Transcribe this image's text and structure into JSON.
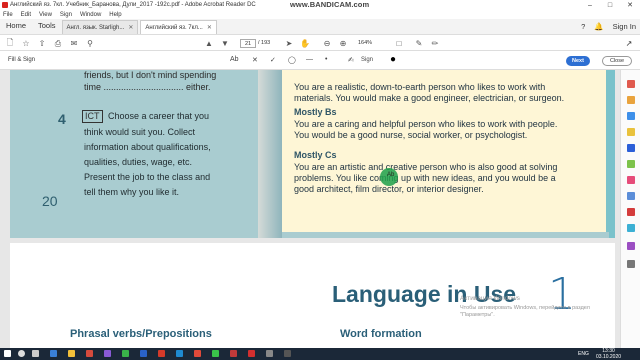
{
  "window": {
    "title": "Английский яз. 7кл. Учебник_Баранова, Дули_2017 -192с.pdf - Adobe Acrobat Reader DC",
    "watermark": "www.BANDICAM.com"
  },
  "menu": [
    "File",
    "Edit",
    "View",
    "Sign",
    "Window",
    "Help"
  ],
  "tabs": {
    "home": "Home",
    "tools": "Tools",
    "docs": [
      {
        "label": "Англ. язык. Starligh...",
        "active": false
      },
      {
        "label": "Английский яз. 7кл...",
        "active": true
      }
    ],
    "help": "?",
    "signin": "Sign In"
  },
  "toolbar": {
    "page_current": "21",
    "page_total": "/ 193",
    "zoom": "164%"
  },
  "fillsign": {
    "label": "Fill & Sign",
    "ab": "Ab",
    "sign": "Sign",
    "next": "Next",
    "close": "Close"
  },
  "page1": {
    "top_line": "friends, but I don't mind spending",
    "time_line": "time ................................ either.",
    "exercise_number": "4",
    "ict": "ICT",
    "exercise_lines": [
      "Choose a career that you",
      "think would suit you. Collect",
      "information about qualifications,",
      "qualities, duties, wage, etc.",
      "Present the job to the class and",
      "tell them why you like it."
    ],
    "page_number": "20",
    "mostly_as_lines": [
      "You are a realistic, down-to-earth person who likes to work with",
      "materials. You would make a good engineer, electrician, or surgeon."
    ],
    "mostly_bs_heading": "Mostly Bs",
    "mostly_bs_lines": [
      "You are a caring and helpful person who likes to work with people.",
      "You would be a good nurse, social worker, or psychologist."
    ],
    "mostly_cs_heading": "Mostly Cs",
    "mostly_cs_lines": [
      "You are an artistic and creative person who is also good at solving",
      "problems. You like coming up with new ideas, and you would be a",
      "good architect, film director, or interior designer."
    ],
    "cursor_label": "Ab"
  },
  "page2": {
    "title": "Language in Use",
    "module_number": "1",
    "section_left": "Phrasal verbs/Prepositions",
    "section_right": "Word formation",
    "activation_title": "Активация Windows",
    "activation_text": "Чтобы активировать Windows, перейдите в раздел \"Параметры\"."
  },
  "taskbar": {
    "lang": "ENG",
    "time": "13:30",
    "date": "03.10.2020"
  }
}
